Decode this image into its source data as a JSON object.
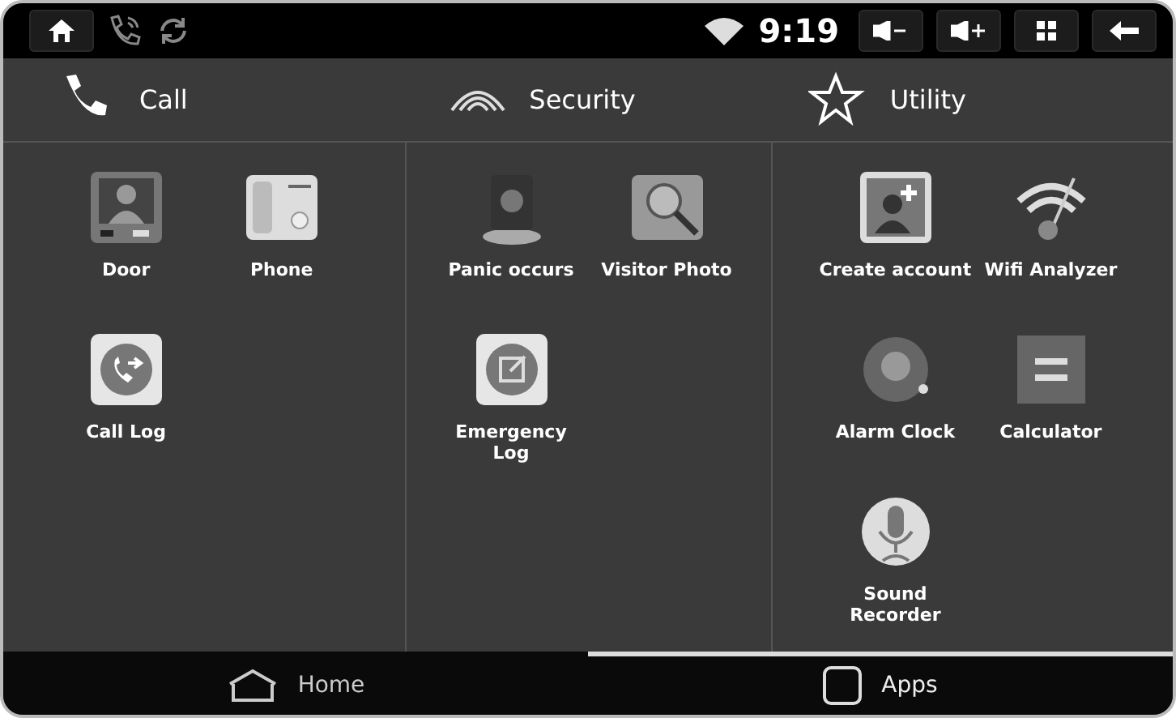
{
  "status_bar": {
    "time": "9:19"
  },
  "categories": [
    {
      "label": "Call",
      "apps": [
        {
          "label": "Door"
        },
        {
          "label": "Phone"
        },
        {
          "label": "Call Log"
        }
      ]
    },
    {
      "label": "Security",
      "apps": [
        {
          "label": "Panic occurs"
        },
        {
          "label": "Visitor Photo"
        },
        {
          "label": "Emergency Log"
        }
      ]
    },
    {
      "label": "Utility",
      "apps": [
        {
          "label": "Create account"
        },
        {
          "label": "Wifi Analyzer"
        },
        {
          "label": "Alarm Clock"
        },
        {
          "label": "Calculator"
        },
        {
          "label": "Sound Recorder"
        }
      ]
    }
  ],
  "bottom_nav": [
    {
      "label": "Home",
      "selected": false
    },
    {
      "label": "Apps",
      "selected": true
    }
  ]
}
